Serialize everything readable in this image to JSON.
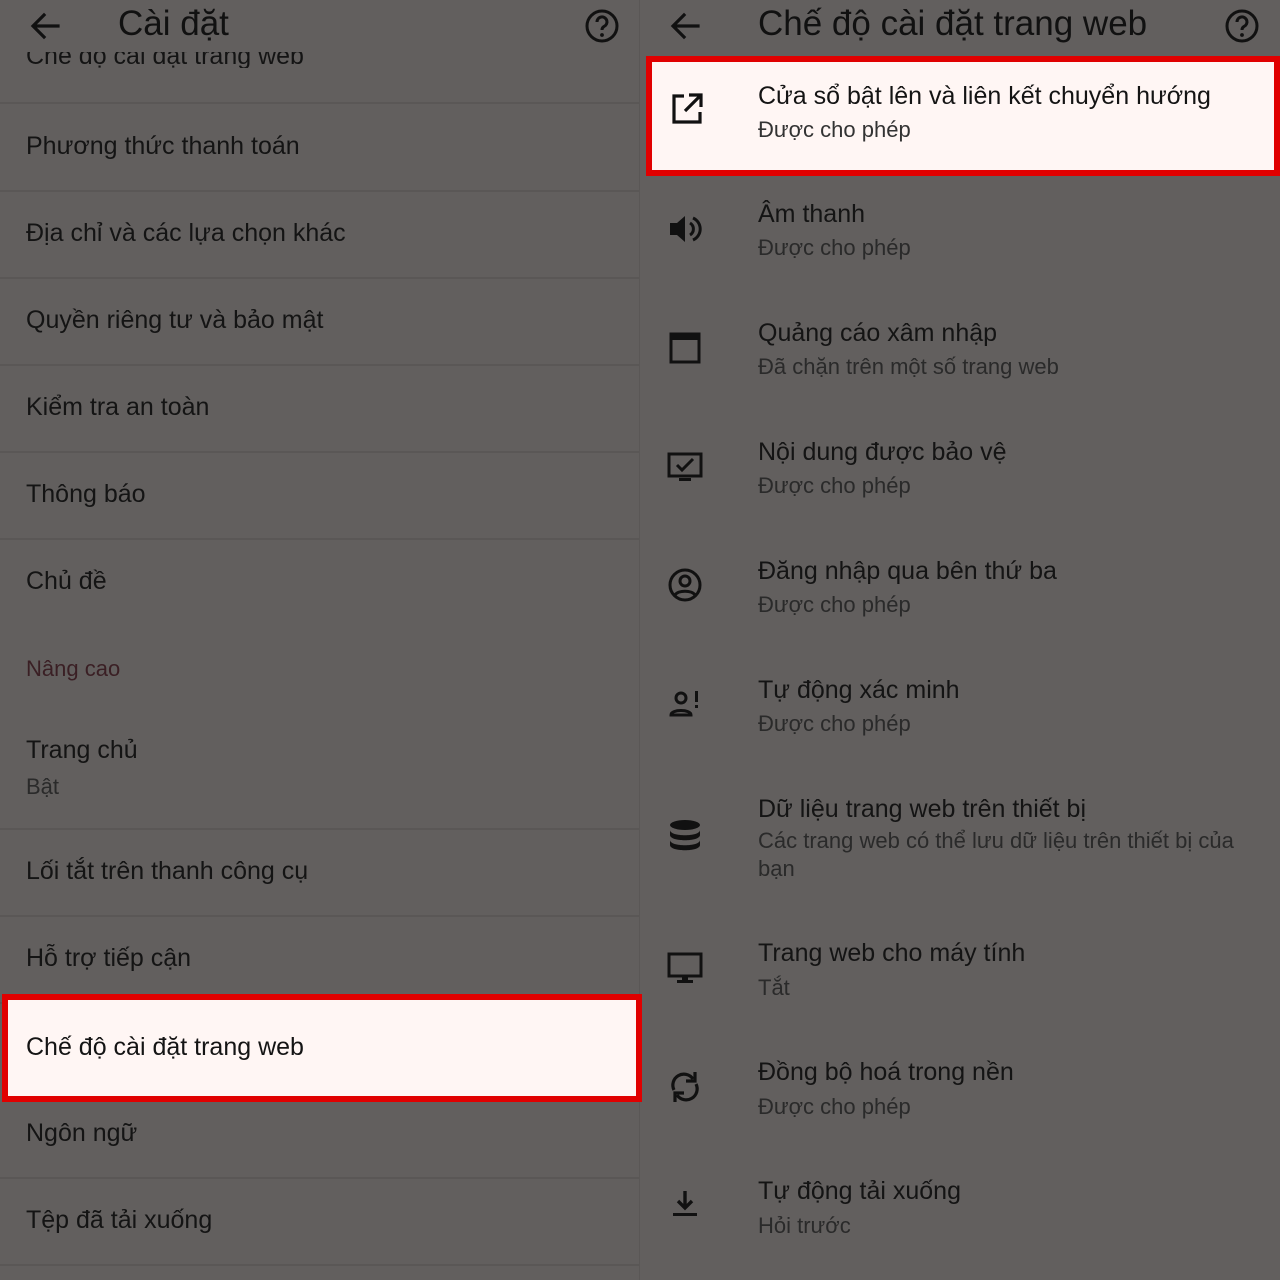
{
  "left": {
    "title": "Cài đặt",
    "partial_item": "Chế độ cài đặt trang web",
    "items": [
      {
        "label": "Phương thức thanh toán"
      },
      {
        "label": "Địa chỉ và các lựa chọn khác"
      },
      {
        "label": "Quyền riêng tư và bảo mật"
      },
      {
        "label": "Kiểm tra an toàn"
      },
      {
        "label": "Thông báo"
      },
      {
        "label": "Chủ đề"
      }
    ],
    "section_header": "Nâng cao",
    "advanced": [
      {
        "label": "Trang chủ",
        "sub": "Bật"
      },
      {
        "label": "Lối tắt trên thanh công cụ"
      },
      {
        "label": "Hỗ trợ tiếp cận"
      },
      {
        "label": "Chế độ cài đặt trang web"
      },
      {
        "label": "Ngôn ngữ"
      },
      {
        "label": "Tệp đã tải xuống"
      }
    ]
  },
  "right": {
    "title": "Chế độ cài đặt trang web",
    "items": [
      {
        "label": "Cửa sổ bật lên và liên kết chuyển hướng",
        "sub": "Được cho phép",
        "icon": "open-in-new-icon"
      },
      {
        "label": "Âm thanh",
        "sub": "Được cho phép",
        "icon": "volume-icon"
      },
      {
        "label": "Quảng cáo xâm nhập",
        "sub": "Đã chặn trên một số trang web",
        "icon": "window-icon"
      },
      {
        "label": "Nội dung được bảo vệ",
        "sub": "Được cho phép",
        "icon": "protected-content-icon"
      },
      {
        "label": "Đăng nhập qua bên thứ ba",
        "sub": "Được cho phép",
        "icon": "account-circle-icon"
      },
      {
        "label": "Tự động xác minh",
        "sub": "Được cho phép",
        "icon": "person-alert-icon"
      },
      {
        "label": "Dữ liệu trang web trên thiết bị",
        "sub": "Các trang web có thể lưu dữ liệu trên thiết bị của bạn",
        "icon": "database-icon"
      },
      {
        "label": "Trang web cho máy tính",
        "sub": "Tắt",
        "icon": "desktop-icon"
      },
      {
        "label": "Đồng bộ hoá trong nền",
        "sub": "Được cho phép",
        "icon": "sync-icon"
      },
      {
        "label": "Tự động tải xuống",
        "sub": "Hỏi trước",
        "icon": "download-icon"
      }
    ]
  },
  "colors": {
    "highlight": "#e00000",
    "background": "#625f5e",
    "highlight_fill": "#fff6f4"
  }
}
